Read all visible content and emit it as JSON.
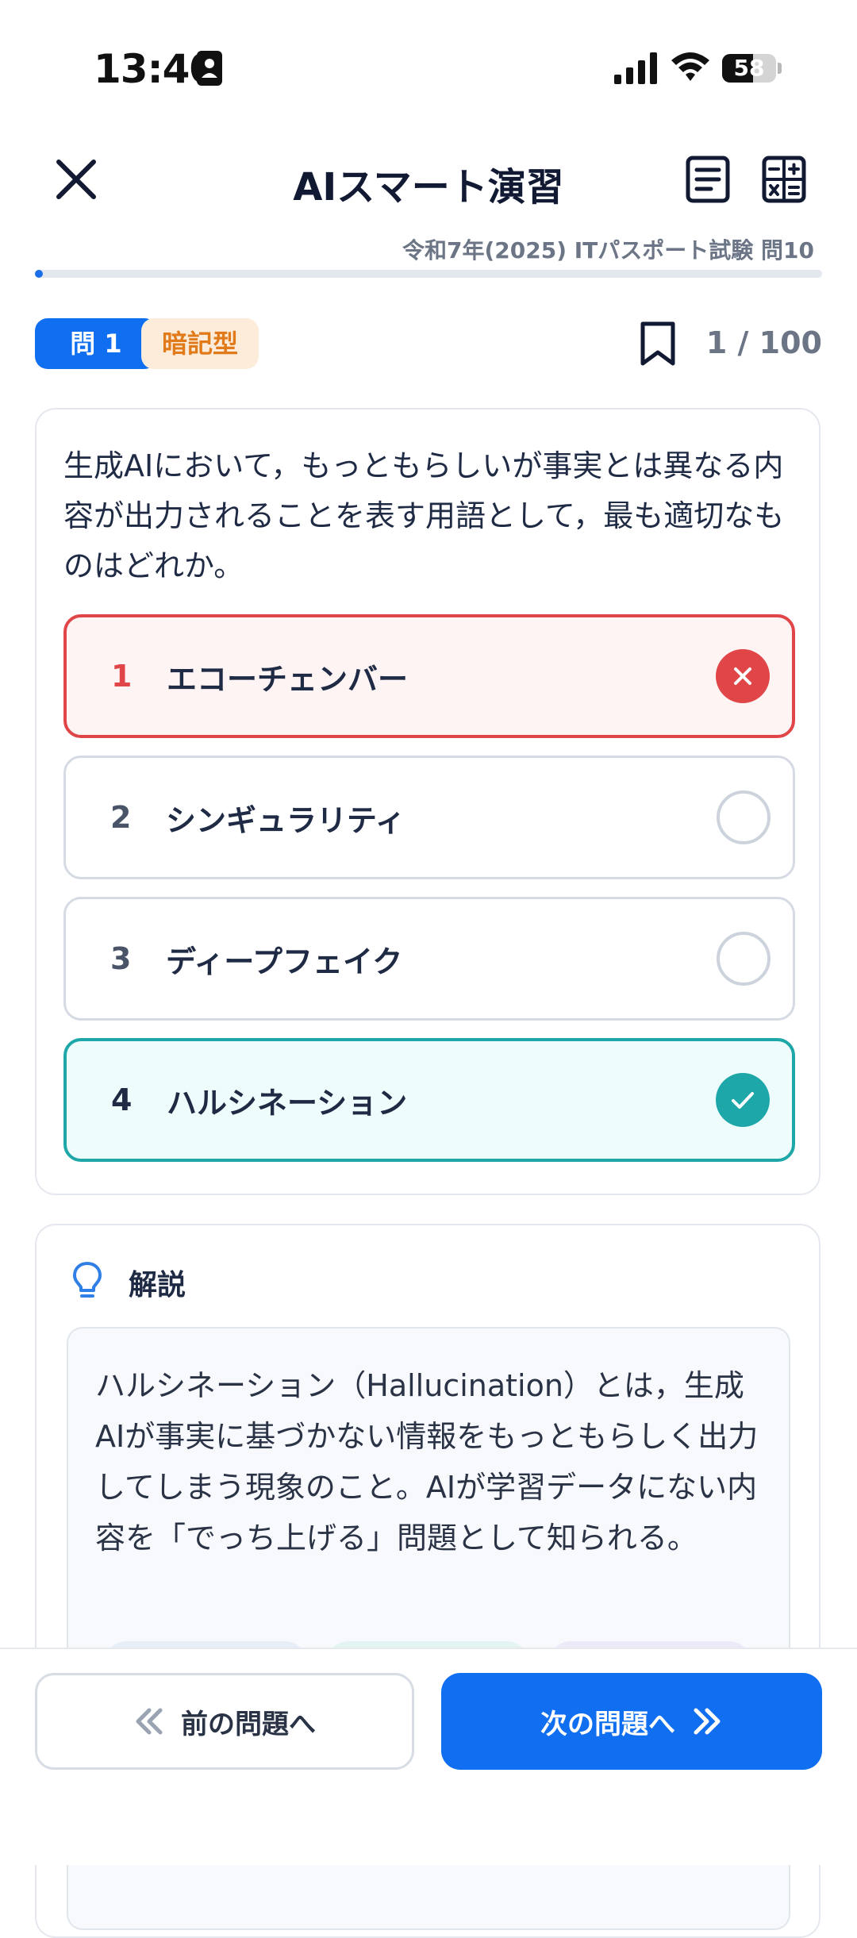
{
  "status_bar": {
    "time": "13:40",
    "battery_level": "58",
    "battery_fraction": 0.58
  },
  "header": {
    "title": "AIスマート演習",
    "exam_label": "令和7年(2025) ITパスポート試験 問10",
    "progress_fraction": 0.01
  },
  "meta": {
    "question_badge": "問 1",
    "type_badge": "暗記型",
    "counter": "1 / 100"
  },
  "question": {
    "text": "生成AIにおいて，もっともらしいが事実とは異なる内容が出力されることを表す用語として，最も適切なものはどれか。"
  },
  "choices": [
    {
      "number": "1",
      "text": "エコーチェンバー",
      "state": "wrong"
    },
    {
      "number": "2",
      "text": "シンギュラリティ",
      "state": "none"
    },
    {
      "number": "3",
      "text": "ディープフェイク",
      "state": "none"
    },
    {
      "number": "4",
      "text": "ハルシネーション",
      "state": "correct"
    }
  ],
  "explanation": {
    "title": "解説",
    "text": "ハルシネーション（Hallucination）とは，生成AIが事実に基づかない情報をもっともらしく出力してしまう現象のこと。AIが学習データにない内容を「でっち上げる」問題として知られる。"
  },
  "navigation": {
    "prev_label": "前の問題へ",
    "next_label": "次の問題へ"
  },
  "colors": {
    "primary": "#0f6ff0",
    "wrong": "#e04548",
    "correct": "#1ea7a8",
    "tag_blue": "#e6eef7",
    "tag_teal": "#e3f4f2",
    "tag_purple": "#ece9f8"
  }
}
